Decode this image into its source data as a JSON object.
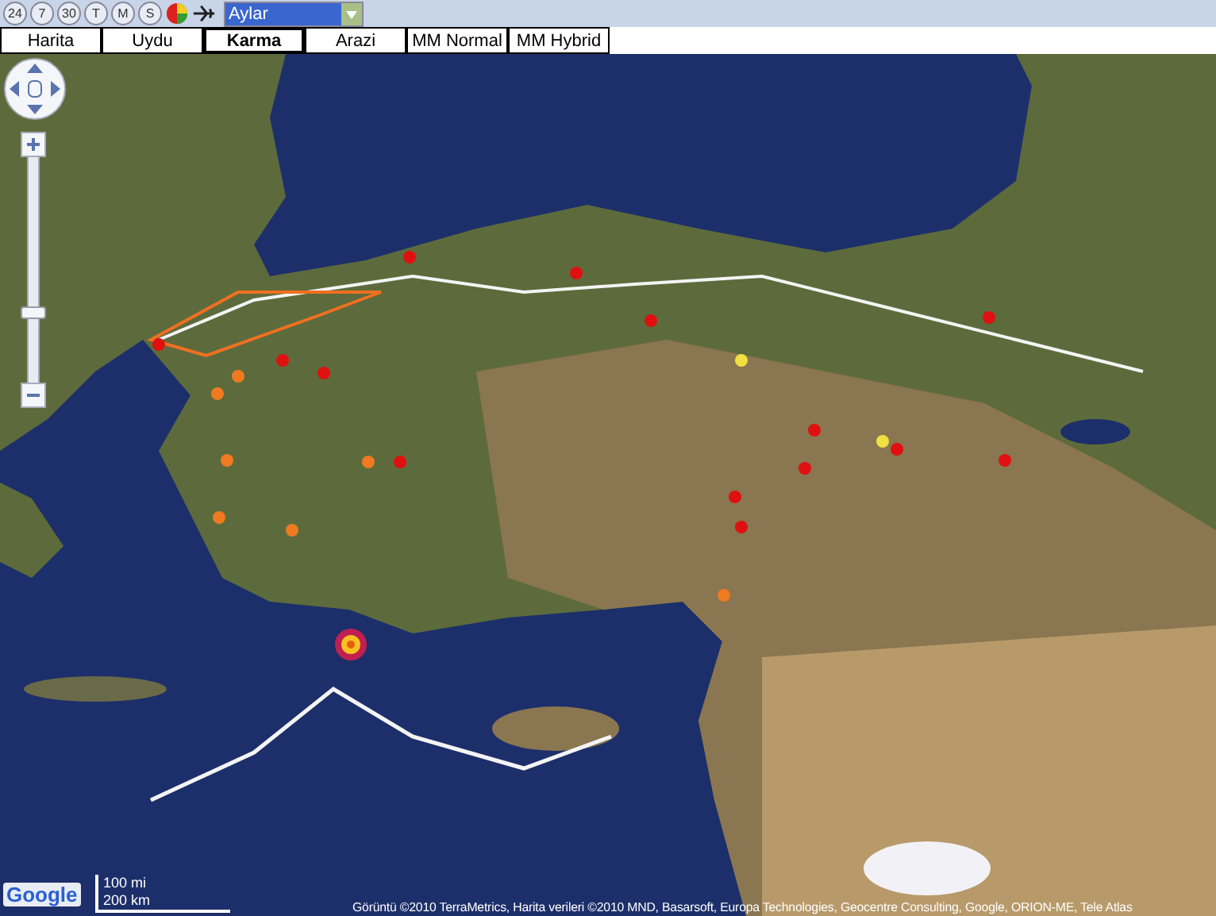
{
  "toolbar": {
    "buttons": [
      {
        "label": "24"
      },
      {
        "label": "7"
      },
      {
        "label": "30"
      },
      {
        "label": "T"
      },
      {
        "label": "M"
      },
      {
        "label": "S"
      }
    ],
    "period_select": {
      "value": "Aylar"
    }
  },
  "map_types": [
    {
      "label": "Harita",
      "selected": false
    },
    {
      "label": "Uydu",
      "selected": false
    },
    {
      "label": "Karma",
      "selected": true
    },
    {
      "label": "Arazi",
      "selected": false
    },
    {
      "label": "MM Normal",
      "selected": false
    },
    {
      "label": "MM Hybrid",
      "selected": false
    }
  ],
  "zoom": {
    "level": 0.32
  },
  "scale": {
    "miles": "100 mi",
    "km": "200 km"
  },
  "logo": "Google",
  "attribution": "Görüntü ©2010 TerraMetrics, Harita verileri ©2010 MND, Basarsoft, Europa Technologies, Geocentre Consulting, Google, ORION-ME, Tele Atlas"
}
